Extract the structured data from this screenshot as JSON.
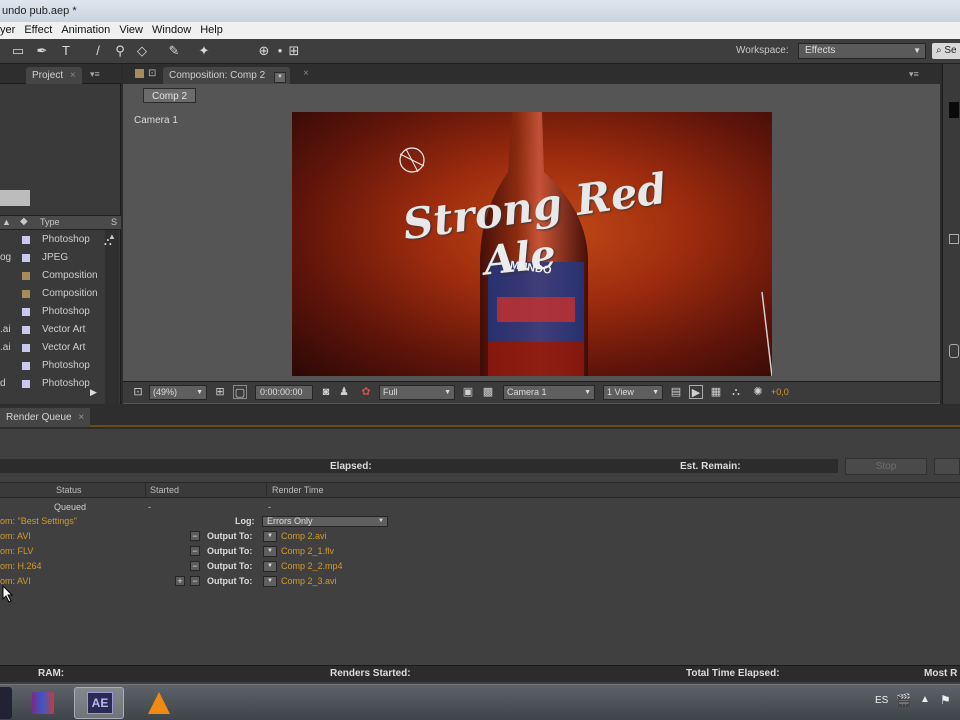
{
  "window": {
    "title": "undo pub.aep *"
  },
  "menu": [
    "yer",
    "Effect",
    "Animation",
    "View",
    "Window",
    "Help"
  ],
  "toolbar": {
    "workspace_label": "Workspace:",
    "workspace_value": "Effects",
    "search_text": "Se"
  },
  "project": {
    "tab_label": "Project",
    "header_type": "Type",
    "header_s": "S",
    "items": [
      {
        "ext": "",
        "type": "Photoshop",
        "color": "#c9c9f0"
      },
      {
        "ext": "og",
        "type": "JPEG",
        "color": "#c9c9f0"
      },
      {
        "ext": "",
        "type": "Composition",
        "color": "#a68b5b"
      },
      {
        "ext": "",
        "type": "Composition",
        "color": "#a68b5b"
      },
      {
        "ext": "",
        "type": "Photoshop",
        "color": "#c9c9f0"
      },
      {
        "ext": ".ai",
        "type": "Vector Art",
        "color": "#c9c9f0"
      },
      {
        "ext": ".ai",
        "type": "Vector Art",
        "color": "#c9c9f0"
      },
      {
        "ext": "",
        "type": "Photoshop",
        "color": "#c9c9f0"
      },
      {
        "ext": "d",
        "type": "Photoshop",
        "color": "#c9c9f0"
      }
    ]
  },
  "composition": {
    "tab_label": "Composition: Comp 2",
    "subtab": "Comp 2",
    "camera_label": "Camera 1",
    "viewer_text_line1": "Strong Red",
    "viewer_text_line2": "Ale",
    "bottle_label": "MUNDO",
    "bottom": {
      "zoom": "(49%)",
      "timecode": "0:00:00:00",
      "resolution": "Full",
      "camera": "Camera 1",
      "views": "1 View",
      "exposure": "+0,0"
    }
  },
  "render_queue": {
    "tab_label": "Render Queue",
    "elapsed_label": "Elapsed:",
    "est_remain_label": "Est. Remain:",
    "stop_label": "Stop",
    "headers": {
      "status": "Status",
      "started": "Started",
      "render_time": "Render Time"
    },
    "status_value": "Queued",
    "started_value": "-",
    "render_time_value": "-",
    "settings_text": "om: \"Best Settings\"",
    "log_label": "Log:",
    "log_value": "Errors Only",
    "outputs": [
      {
        "module": "om: AVI",
        "label": "Output To:",
        "file": "Comp 2.avi"
      },
      {
        "module": "om: FLV",
        "label": "Output To:",
        "file": "Comp 2_1.flv"
      },
      {
        "module": "om: H.264",
        "label": "Output To:",
        "file": "Comp 2_2.mp4"
      },
      {
        "module": "om: AVI",
        "label": "Output To:",
        "file": "Comp 2_3.avi"
      }
    ],
    "footer": {
      "ram": "RAM:",
      "renders_started": "Renders Started:",
      "total_time": "Total Time Elapsed:",
      "most_recent": "Most R"
    }
  },
  "taskbar": {
    "language": "ES",
    "ae_label": "AE"
  }
}
